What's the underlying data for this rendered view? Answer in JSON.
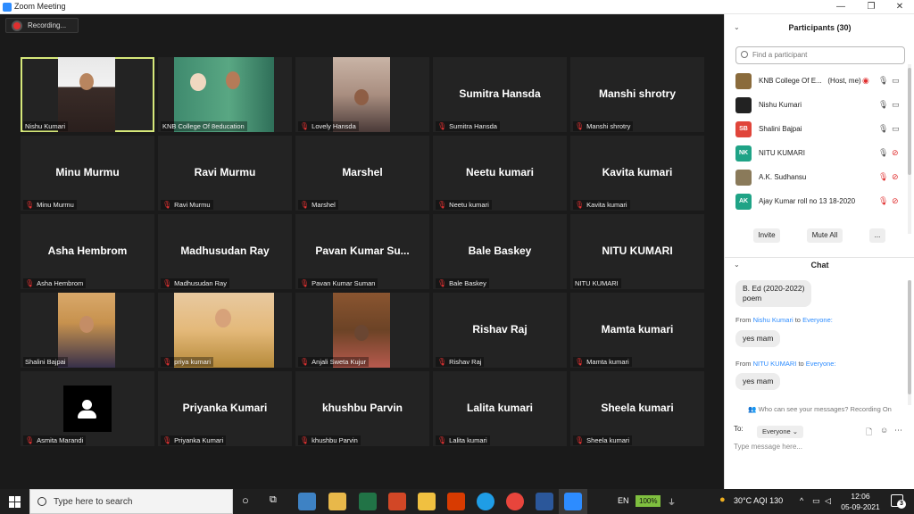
{
  "window": {
    "title": "Zoom Meeting",
    "minimize": "—",
    "maximize": "❐",
    "close": "✕"
  },
  "recording": {
    "label": "Recording..."
  },
  "tiles": [
    {
      "big": "",
      "name": "Nishu Kumari",
      "muted": false
    },
    {
      "big": "",
      "name": "KNB College Of 8education",
      "muted": false
    },
    {
      "big": "",
      "name": "Lovely Hansda",
      "muted": true
    },
    {
      "big": "Sumitra Hansda",
      "name": "Sumitra Hansda",
      "muted": true
    },
    {
      "big": "Manshi shrotry",
      "name": "Manshi shrotry",
      "muted": true
    },
    {
      "big": "Minu Murmu",
      "name": "Minu Murmu",
      "muted": true
    },
    {
      "big": "Ravi Murmu",
      "name": "Ravi Murmu",
      "muted": true
    },
    {
      "big": "Marshel",
      "name": "Marshel",
      "muted": true
    },
    {
      "big": "Neetu kumari",
      "name": "Neetu kumari",
      "muted": true
    },
    {
      "big": "Kavita kumari",
      "name": "Kavita kumari",
      "muted": true
    },
    {
      "big": "Asha Hembrom",
      "name": "Asha Hembrom",
      "muted": true
    },
    {
      "big": "Madhusudan Ray",
      "name": "Madhusudan Ray",
      "muted": true
    },
    {
      "big": "Pavan Kumar Su...",
      "name": "Pavan Kumar Suman",
      "muted": true
    },
    {
      "big": "Bale Baskey",
      "name": "Bale Baskey",
      "muted": true
    },
    {
      "big": "NITU KUMARI",
      "name": "NITU KUMARI",
      "muted": false
    },
    {
      "big": "",
      "name": "Shalini Bajpai",
      "muted": false
    },
    {
      "big": "",
      "name": "priya kumari",
      "muted": true
    },
    {
      "big": "",
      "name": "Anjali Sweta Kujur",
      "muted": true
    },
    {
      "big": "Rishav Raj",
      "name": "Rishav Raj",
      "muted": true
    },
    {
      "big": "Mamta kumari",
      "name": "Mamta kumari",
      "muted": true
    },
    {
      "big": "",
      "name": "Asmita Marandi",
      "muted": true
    },
    {
      "big": "Priyanka Kumari",
      "name": "Priyanka Kumari",
      "muted": true
    },
    {
      "big": "khushbu Parvin",
      "name": "khushbu Parvin",
      "muted": true
    },
    {
      "big": "Lalita kumari",
      "name": "Lalita kumari",
      "muted": true
    },
    {
      "big": "Sheela kumari",
      "name": "Sheela kumari",
      "muted": true
    }
  ],
  "participants": {
    "header": "Participants (30)",
    "search_placeholder": "Find a participant",
    "list": [
      {
        "initials": "",
        "name": "KNB College Of E...",
        "tag": "(Host, me)",
        "color": "#8a6b3c"
      },
      {
        "initials": "",
        "name": "Nishu Kumari",
        "tag": "",
        "color": "#222222"
      },
      {
        "initials": "SB",
        "name": "Shalini Bajpai",
        "tag": "",
        "color": "#e0453a"
      },
      {
        "initials": "NK",
        "name": "NITU KUMARI",
        "tag": "",
        "color": "#1fa386"
      },
      {
        "initials": "",
        "name": "A.K. Sudhansu",
        "tag": "",
        "color": "#8a7a5a"
      },
      {
        "initials": "AK",
        "name": "Ajay Kumar roll no 13 18-2020",
        "tag": "",
        "color": "#1fa386"
      }
    ],
    "invite": "Invite",
    "mute_all": "Mute All",
    "more": "..."
  },
  "chat": {
    "header": "Chat",
    "msg1_line1": "B. Ed (2020-2022)",
    "msg1_line2": "poem",
    "from1_prefix": "From",
    "from1_name": "Nishu Kumari",
    "from1_mid": "to",
    "from1_to": "Everyone:",
    "msg2": "yes mam",
    "from2_prefix": "From",
    "from2_name": "NITU KUMARI",
    "from2_mid": "to",
    "from2_to": "Everyone:",
    "msg3": "yes mam",
    "who_can_see": "Who can see your messages? Recording On",
    "to_label": "To:",
    "to_value": "Everyone",
    "input_placeholder": "Type message here..."
  },
  "taskbar": {
    "search_text": "Type here to search",
    "lang": "EN",
    "battery": "100%",
    "weather": "30°C  AQI 130",
    "time": "12:06",
    "date": "05-09-2021",
    "notif_count": "3"
  }
}
